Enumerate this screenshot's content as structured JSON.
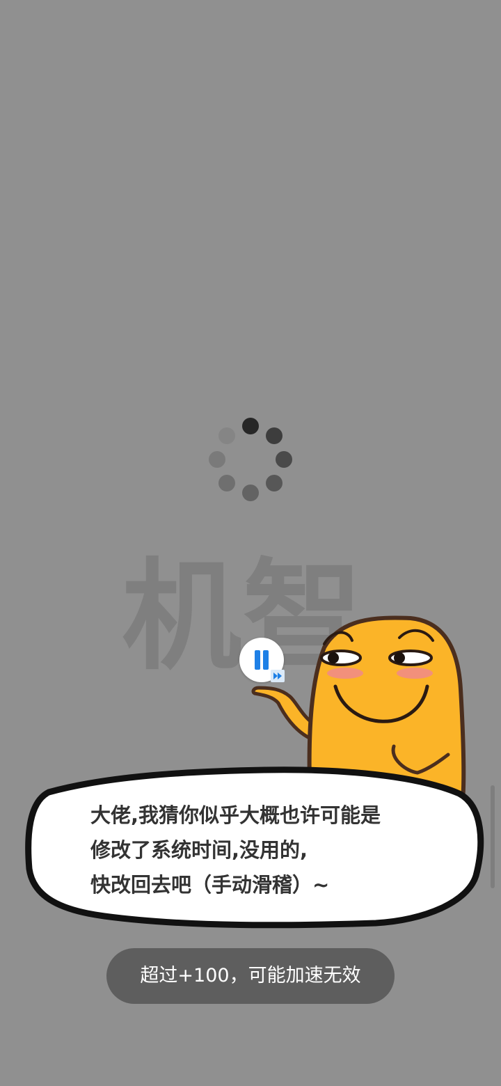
{
  "watermark": {
    "text": "机智"
  },
  "speech_bubble": {
    "lines": [
      "大佬,我猜你似乎大概也许可能是",
      "修改了系统时间,没用的,",
      "快改回去吧（手动滑稽）~"
    ]
  },
  "toast": {
    "message": "超过+100，可能加速无效"
  },
  "floating_controls": {
    "pause_icon": "pause-icon",
    "fast_forward_icon": "fast-forward-icon"
  },
  "colors": {
    "background": "#909090",
    "mascot": "#fbb428",
    "accent_blue": "#1e80e6",
    "toast_bg": "#5e5e5e"
  }
}
